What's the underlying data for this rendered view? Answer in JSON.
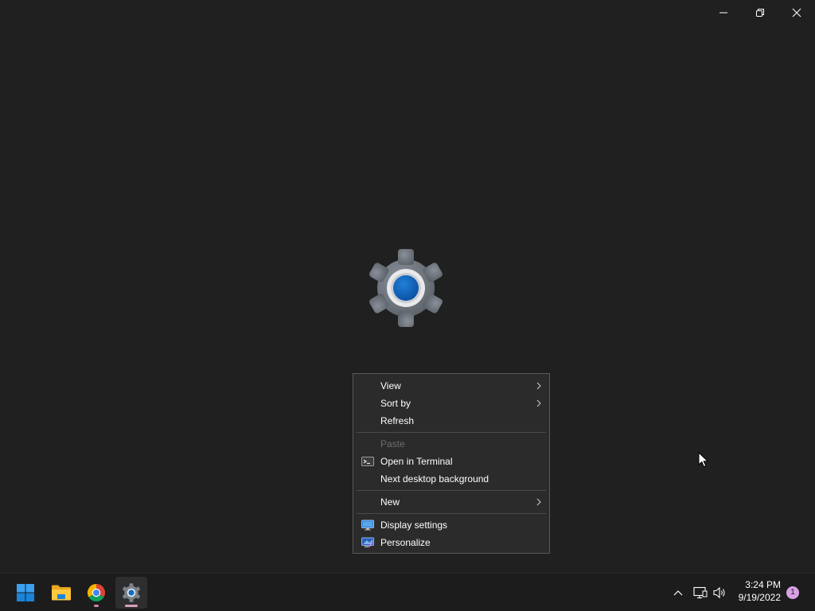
{
  "context_menu": {
    "items": [
      {
        "label": "View",
        "submenu": true
      },
      {
        "label": "Sort by",
        "submenu": true
      },
      {
        "label": "Refresh"
      },
      {
        "label": "Paste",
        "disabled": true
      },
      {
        "label": "Open in Terminal",
        "icon": "terminal-icon"
      },
      {
        "label": "Next desktop background"
      },
      {
        "label": "New",
        "submenu": true
      },
      {
        "label": "Display settings",
        "icon": "display-settings-icon"
      },
      {
        "label": "Personalize",
        "icon": "personalize-icon"
      }
    ]
  },
  "window_controls": {
    "icons": [
      "minimize-icon",
      "restore-icon",
      "close-icon"
    ]
  },
  "taskbar": {
    "apps": [
      {
        "name": "Start",
        "icon": "windows-start-icon"
      },
      {
        "name": "File Explorer",
        "icon": "folder-icon"
      },
      {
        "name": "Google Chrome",
        "icon": "chrome-icon",
        "running": true
      },
      {
        "name": "Settings",
        "icon": "settings-gear-icon",
        "active": true
      }
    ],
    "tray": {
      "icons": [
        "chevron-up-icon",
        "network-icon",
        "volume-icon"
      ],
      "time": "3:24 PM",
      "date": "9/19/2022",
      "notification_count": "1"
    }
  },
  "colors": {
    "desktop_bg": "#202020",
    "menu_bg": "#2b2b2b",
    "accent_blue": "#0f6cbd",
    "notification_badge": "#d9a0e3"
  }
}
